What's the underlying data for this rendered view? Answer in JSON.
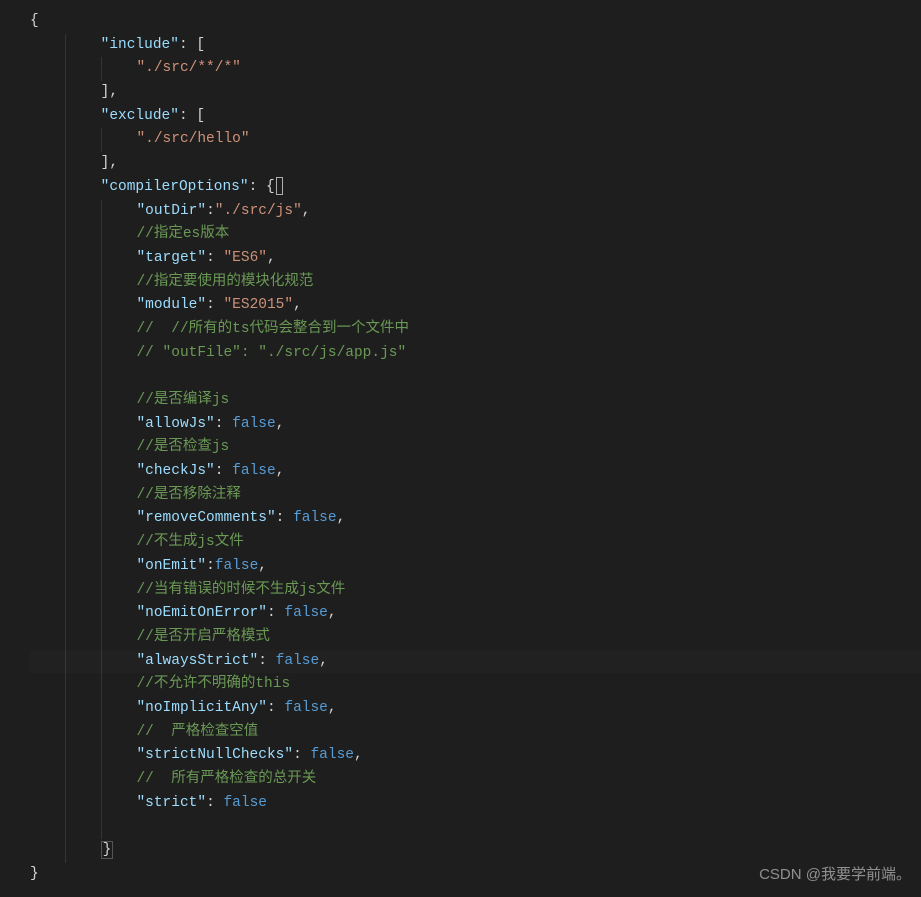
{
  "watermark": "CSDN @我要学前端。",
  "lines": [
    {
      "indent": 0,
      "tokens": [
        {
          "t": "brace",
          "v": "{"
        }
      ]
    },
    {
      "indent": 2,
      "tokens": [
        {
          "t": "key",
          "v": "\"include\""
        },
        {
          "t": "p",
          "v": ": "
        },
        {
          "t": "bracket",
          "v": "["
        }
      ]
    },
    {
      "indent": 3,
      "tokens": [
        {
          "t": "str",
          "v": "\"./src/**/*\""
        }
      ]
    },
    {
      "indent": 2,
      "tokens": [
        {
          "t": "bracket",
          "v": "]"
        },
        {
          "t": "p",
          "v": ","
        }
      ]
    },
    {
      "indent": 2,
      "tokens": [
        {
          "t": "key",
          "v": "\"exclude\""
        },
        {
          "t": "p",
          "v": ": "
        },
        {
          "t": "bracket",
          "v": "["
        }
      ]
    },
    {
      "indent": 3,
      "tokens": [
        {
          "t": "str",
          "v": "\"./src/hello\""
        }
      ]
    },
    {
      "indent": 2,
      "tokens": [
        {
          "t": "bracket",
          "v": "]"
        },
        {
          "t": "p",
          "v": ","
        }
      ]
    },
    {
      "indent": 2,
      "tokens": [
        {
          "t": "key",
          "v": "\"compilerOptions\""
        },
        {
          "t": "p",
          "v": ": "
        },
        {
          "t": "brace",
          "v": "{"
        }
      ],
      "cursor": true
    },
    {
      "indent": 3,
      "tokens": [
        {
          "t": "key",
          "v": "\"outDir\""
        },
        {
          "t": "p",
          "v": ":"
        },
        {
          "t": "str",
          "v": "\"./src/js\""
        },
        {
          "t": "p",
          "v": ","
        }
      ]
    },
    {
      "indent": 3,
      "tokens": [
        {
          "t": "comment",
          "v": "//指定es版本"
        }
      ]
    },
    {
      "indent": 3,
      "tokens": [
        {
          "t": "key",
          "v": "\"target\""
        },
        {
          "t": "p",
          "v": ": "
        },
        {
          "t": "str",
          "v": "\"ES6\""
        },
        {
          "t": "p",
          "v": ","
        }
      ]
    },
    {
      "indent": 3,
      "tokens": [
        {
          "t": "comment",
          "v": "//指定要使用的模块化规范"
        }
      ]
    },
    {
      "indent": 3,
      "tokens": [
        {
          "t": "key",
          "v": "\"module\""
        },
        {
          "t": "p",
          "v": ": "
        },
        {
          "t": "str",
          "v": "\"ES2015\""
        },
        {
          "t": "p",
          "v": ","
        }
      ]
    },
    {
      "indent": 3,
      "tokens": [
        {
          "t": "comment",
          "v": "//  //所有的ts代码会整合到一个文件中"
        }
      ]
    },
    {
      "indent": 3,
      "tokens": [
        {
          "t": "comment",
          "v": "// \"outFile\": \"./src/js/app.js\""
        }
      ]
    },
    {
      "indent": 3,
      "tokens": []
    },
    {
      "indent": 3,
      "tokens": [
        {
          "t": "comment",
          "v": "//是否编译js"
        }
      ]
    },
    {
      "indent": 3,
      "tokens": [
        {
          "t": "key",
          "v": "\"allowJs\""
        },
        {
          "t": "p",
          "v": ": "
        },
        {
          "t": "bool",
          "v": "false"
        },
        {
          "t": "p",
          "v": ","
        }
      ]
    },
    {
      "indent": 3,
      "tokens": [
        {
          "t": "comment",
          "v": "//是否检查js"
        }
      ]
    },
    {
      "indent": 3,
      "tokens": [
        {
          "t": "key",
          "v": "\"checkJs\""
        },
        {
          "t": "p",
          "v": ": "
        },
        {
          "t": "bool",
          "v": "false"
        },
        {
          "t": "p",
          "v": ","
        }
      ]
    },
    {
      "indent": 3,
      "tokens": [
        {
          "t": "comment",
          "v": "//是否移除注释"
        }
      ]
    },
    {
      "indent": 3,
      "tokens": [
        {
          "t": "key",
          "v": "\"removeComments\""
        },
        {
          "t": "p",
          "v": ": "
        },
        {
          "t": "bool",
          "v": "false"
        },
        {
          "t": "p",
          "v": ","
        }
      ]
    },
    {
      "indent": 3,
      "tokens": [
        {
          "t": "comment",
          "v": "//不生成js文件"
        }
      ]
    },
    {
      "indent": 3,
      "tokens": [
        {
          "t": "key",
          "v": "\"onEmit\""
        },
        {
          "t": "p",
          "v": ":"
        },
        {
          "t": "bool",
          "v": "false"
        },
        {
          "t": "p",
          "v": ","
        }
      ]
    },
    {
      "indent": 3,
      "tokens": [
        {
          "t": "comment",
          "v": "//当有错误的时候不生成js文件"
        }
      ]
    },
    {
      "indent": 3,
      "tokens": [
        {
          "t": "key",
          "v": "\"noEmitOnError\""
        },
        {
          "t": "p",
          "v": ": "
        },
        {
          "t": "bool",
          "v": "false"
        },
        {
          "t": "p",
          "v": ","
        }
      ]
    },
    {
      "indent": 3,
      "tokens": [
        {
          "t": "comment",
          "v": "//是否开启严格模式"
        }
      ]
    },
    {
      "indent": 3,
      "tokens": [
        {
          "t": "key",
          "v": "\"alwaysStrict\""
        },
        {
          "t": "p",
          "v": ": "
        },
        {
          "t": "bool",
          "v": "false"
        },
        {
          "t": "p",
          "v": ","
        }
      ],
      "highlight": true
    },
    {
      "indent": 3,
      "tokens": [
        {
          "t": "comment",
          "v": "//不允许不明确的this"
        }
      ]
    },
    {
      "indent": 3,
      "tokens": [
        {
          "t": "key",
          "v": "\"noImplicitAny\""
        },
        {
          "t": "p",
          "v": ": "
        },
        {
          "t": "bool",
          "v": "false"
        },
        {
          "t": "p",
          "v": ","
        }
      ]
    },
    {
      "indent": 3,
      "tokens": [
        {
          "t": "comment",
          "v": "//  严格检查空值"
        }
      ]
    },
    {
      "indent": 3,
      "tokens": [
        {
          "t": "key",
          "v": "\"strictNullChecks\""
        },
        {
          "t": "p",
          "v": ": "
        },
        {
          "t": "bool",
          "v": "false"
        },
        {
          "t": "p",
          "v": ","
        }
      ]
    },
    {
      "indent": 3,
      "tokens": [
        {
          "t": "comment",
          "v": "//  所有严格检查的总开关"
        }
      ]
    },
    {
      "indent": 3,
      "tokens": [
        {
          "t": "key",
          "v": "\"strict\""
        },
        {
          "t": "p",
          "v": ": "
        },
        {
          "t": "bool",
          "v": "false"
        }
      ]
    },
    {
      "indent": 3,
      "tokens": []
    },
    {
      "indent": 2,
      "tokens": [
        {
          "t": "brace-close",
          "v": "}"
        }
      ]
    },
    {
      "indent": 0,
      "tokens": [
        {
          "t": "brace",
          "v": "}"
        }
      ]
    }
  ]
}
